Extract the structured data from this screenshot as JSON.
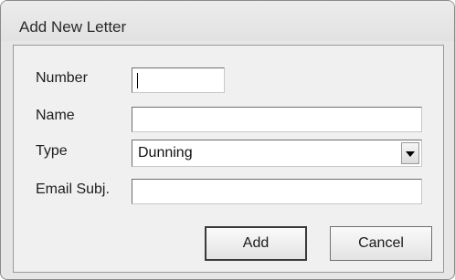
{
  "dialog": {
    "title": "Add New Letter"
  },
  "form": {
    "number": {
      "label": "Number",
      "value": ""
    },
    "name": {
      "label": "Name",
      "value": ""
    },
    "type": {
      "label": "Type",
      "value": "Dunning"
    },
    "email_subject": {
      "label": "Email Subj.",
      "value": ""
    }
  },
  "buttons": {
    "add": "Add",
    "cancel": "Cancel"
  },
  "icons": {
    "dropdown": "chevron-down-icon"
  }
}
